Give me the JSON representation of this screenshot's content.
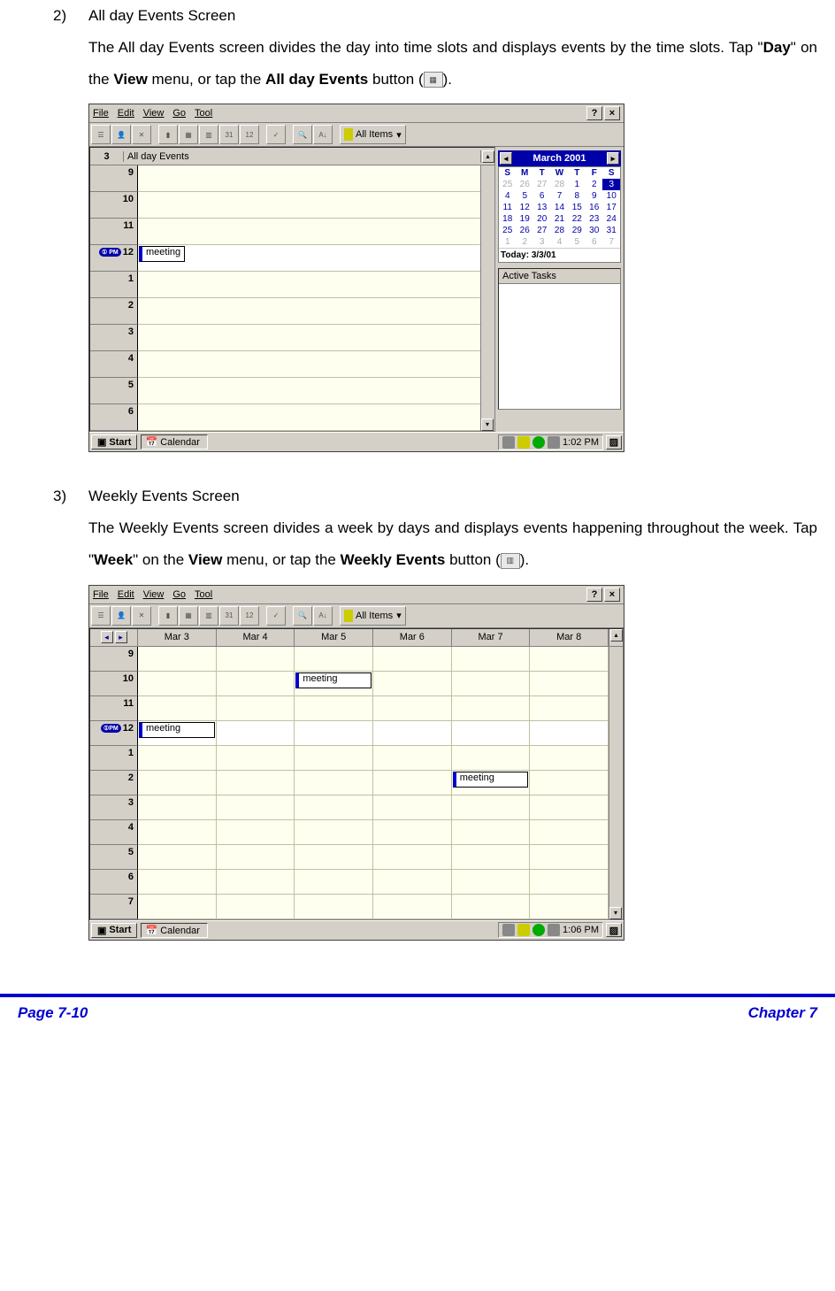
{
  "section2": {
    "num": "2)",
    "title": "All day Events Screen",
    "body_1": "The All day Events screen divides the day into time slots and displays events by the time slots. Tap \"",
    "body_bold1": "Day",
    "body_2": "\" on the ",
    "body_bold2": "View",
    "body_3": " menu, or tap the ",
    "body_bold3": "All day Events",
    "body_4": " button (",
    "body_5": ")."
  },
  "section3": {
    "num": "3)",
    "title": "Weekly Events Screen",
    "body_1": "The Weekly Events screen divides a week by days and displays events happening throughout the week. Tap \"",
    "body_bold1": "Week",
    "body_2": "\" on the ",
    "body_bold2": "View",
    "body_3": " menu, or tap the ",
    "body_bold3": "Weekly Events",
    "body_4": " button (",
    "body_5": ")."
  },
  "app": {
    "menus": {
      "file": "File",
      "edit": "Edit",
      "view": "View",
      "go": "Go",
      "tool": "Tool"
    },
    "help": "?",
    "close": "×",
    "all_items": "All Items",
    "day_num": "3",
    "all_day_label": "All day Events",
    "hours": [
      "9",
      "10",
      "11",
      "12",
      "1",
      "2",
      "3",
      "4",
      "5",
      "6"
    ],
    "pm_label": "PM",
    "event": "meeting",
    "start": "Start",
    "taskapp": "Calendar",
    "minical": {
      "month": "March 2001",
      "dows": [
        "S",
        "M",
        "T",
        "W",
        "T",
        "F",
        "S"
      ],
      "rows": [
        [
          "25",
          "26",
          "27",
          "28",
          "1",
          "2",
          "3"
        ],
        [
          "4",
          "5",
          "6",
          "7",
          "8",
          "9",
          "10"
        ],
        [
          "11",
          "12",
          "13",
          "14",
          "15",
          "16",
          "17"
        ],
        [
          "18",
          "19",
          "20",
          "21",
          "22",
          "23",
          "24"
        ],
        [
          "25",
          "26",
          "27",
          "28",
          "29",
          "30",
          "31"
        ],
        [
          "1",
          "2",
          "3",
          "4",
          "5",
          "6",
          "7"
        ]
      ],
      "today": "Today: 3/3/01"
    },
    "tasks_header": "Active Tasks",
    "clock1": "1:02 PM",
    "clock2": "1:06 PM"
  },
  "week": {
    "days": [
      "Mar 3",
      "Mar 4",
      "Mar 5",
      "Mar 6",
      "Mar 7",
      "Mar 8"
    ],
    "hours": [
      "9",
      "10",
      "11",
      "12",
      "1",
      "2",
      "3",
      "4",
      "5",
      "6",
      "7"
    ],
    "events": [
      {
        "day": 0,
        "hour": 3,
        "label": "meeting"
      },
      {
        "day": 2,
        "hour": 1,
        "label": "meeting"
      },
      {
        "day": 4,
        "hour": 5,
        "label": "meeting"
      }
    ]
  },
  "footer": {
    "left": "Page 7-10",
    "right": "Chapter 7"
  }
}
